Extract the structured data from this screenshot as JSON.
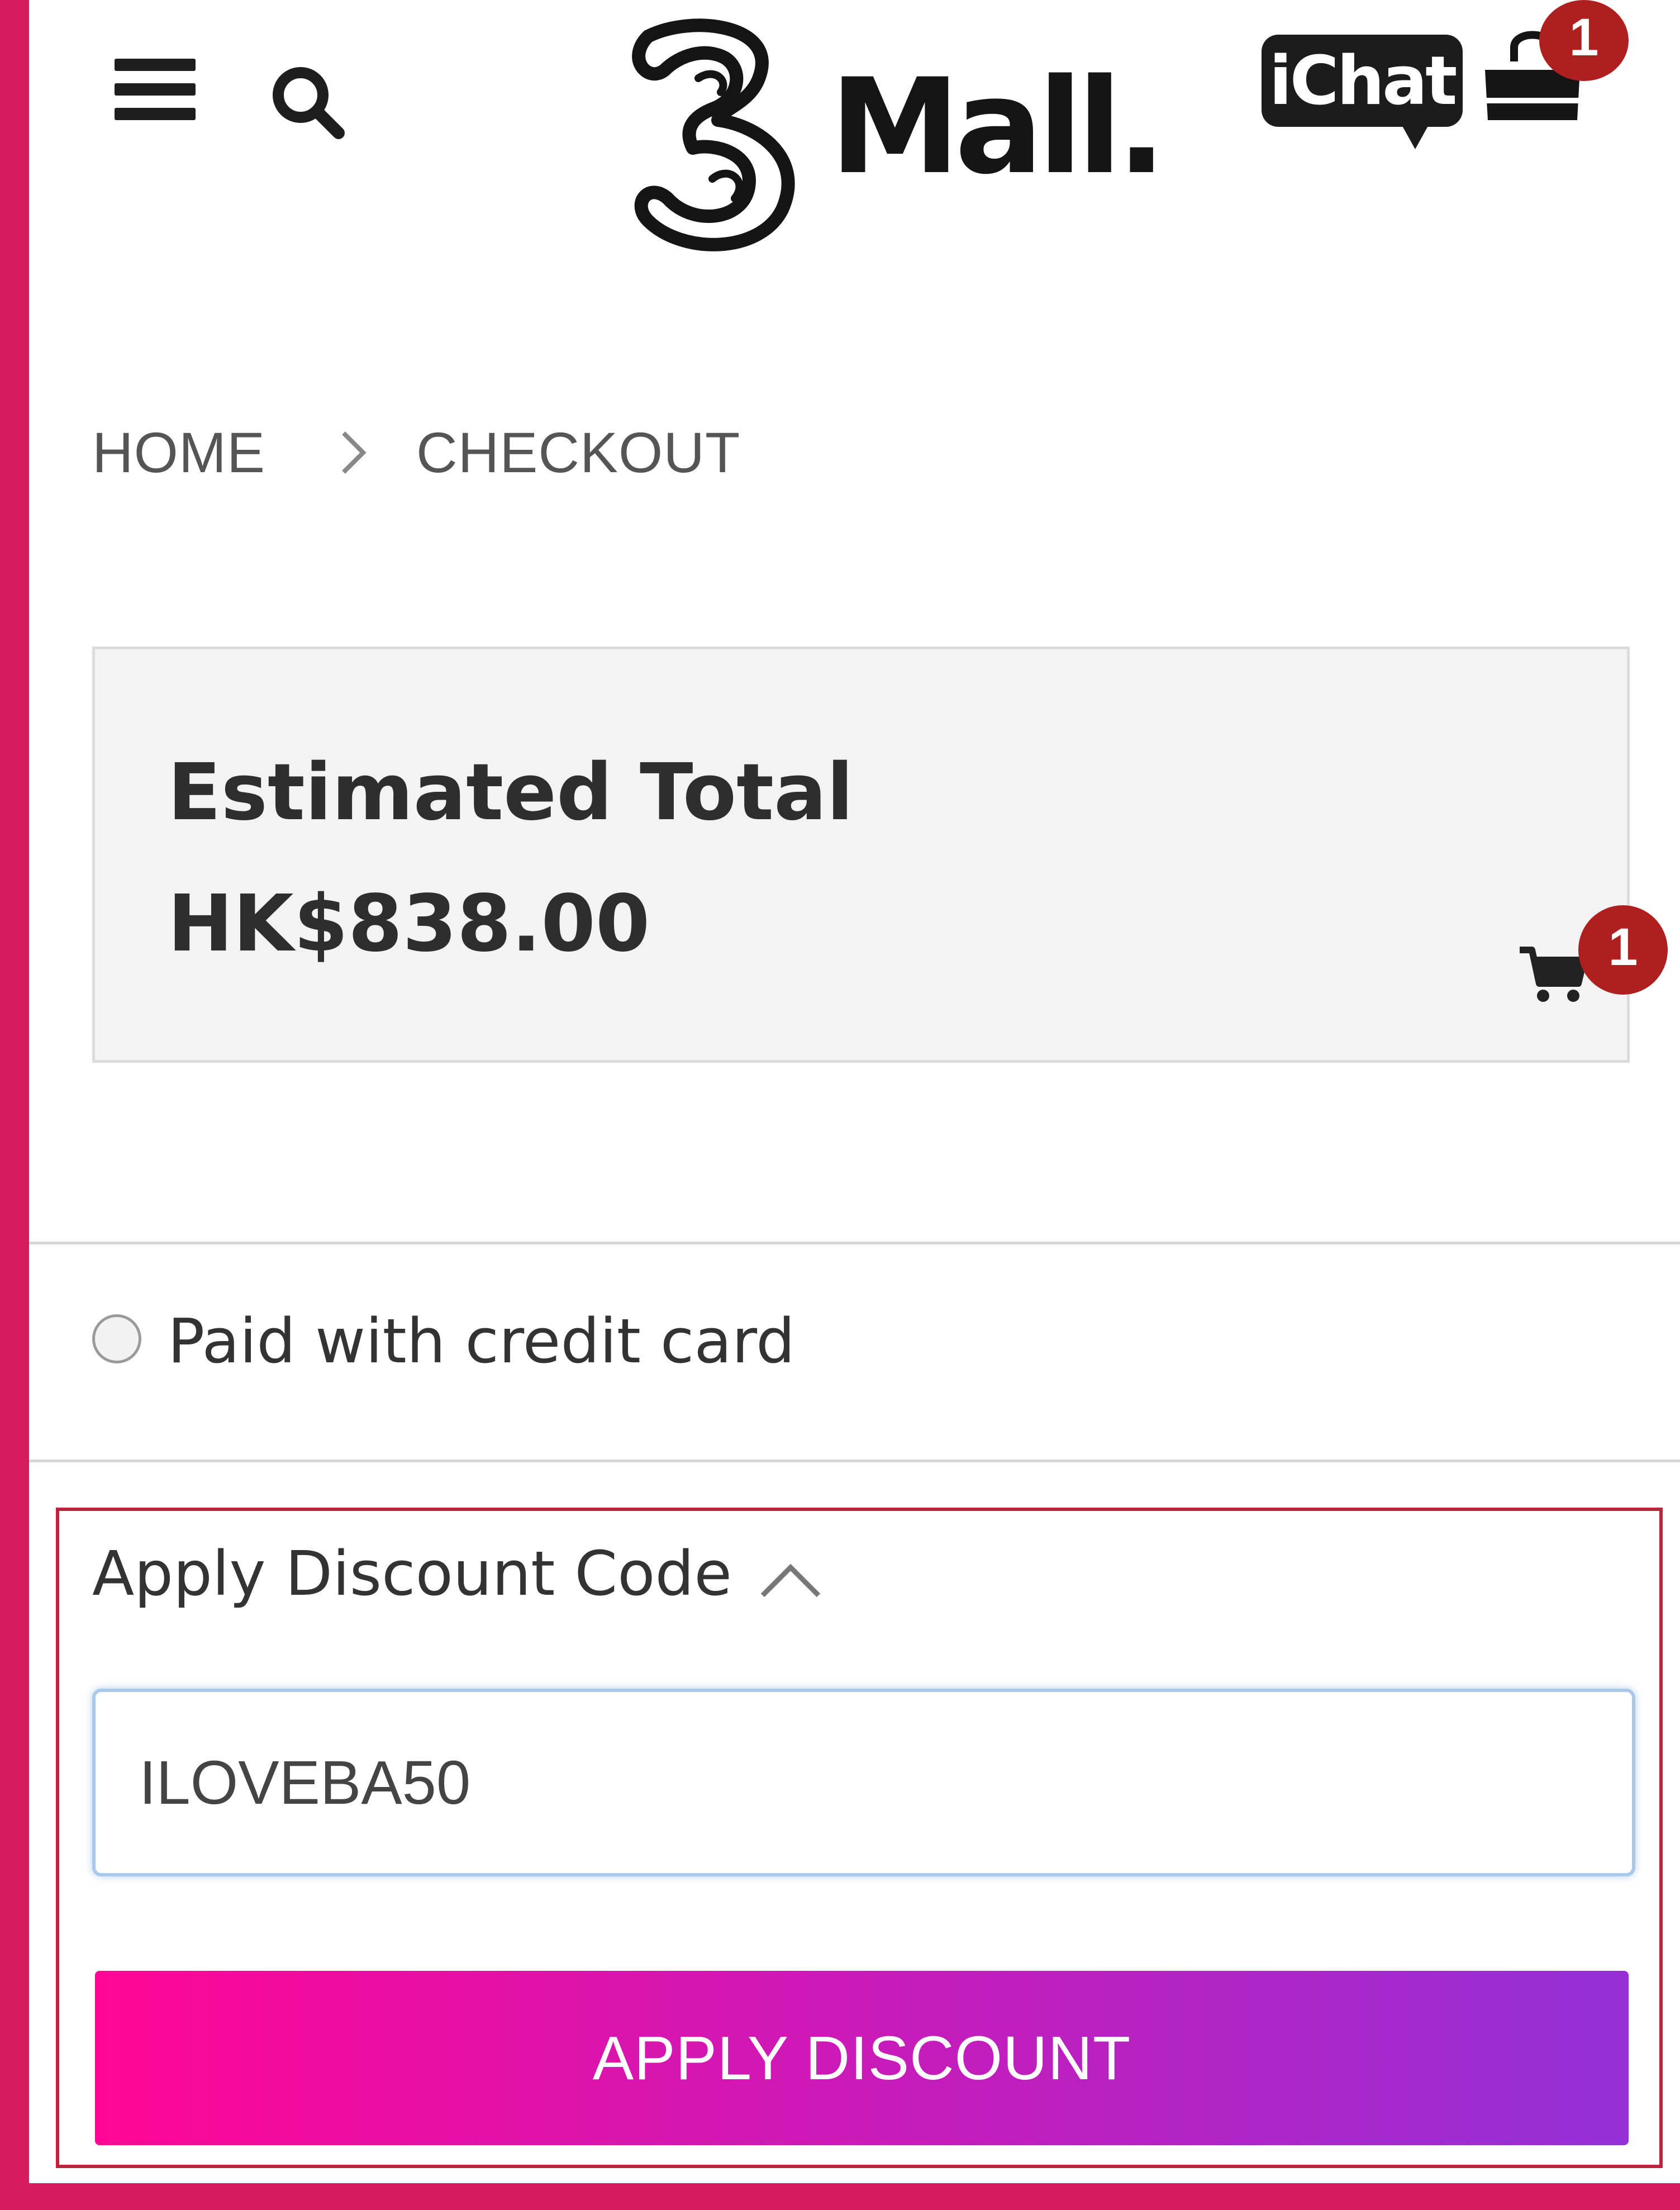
{
  "header": {
    "logo_text": "Mall.",
    "chat_label": "iChat",
    "bag_badge_count": "1",
    "icons": [
      "menu-icon",
      "search-icon",
      "logo-three-icon",
      "ichat-icon",
      "shopping-bag-icon"
    ]
  },
  "breadcrumb": {
    "home": "HOME",
    "current": "CHECKOUT",
    "separator_icon": "chevron-right-icon"
  },
  "summary": {
    "label": "Estimated Total",
    "value": "HK$838.00",
    "cart_badge_count": "1",
    "cart_icon": "cart-icon"
  },
  "payment": {
    "option_label": "Paid with credit card",
    "selected": false
  },
  "discount": {
    "title": "Apply Discount Code",
    "toggle_icon": "chevron-up-icon",
    "input_value": "ILOVEBA50",
    "button_label": "APPLY DISCOUNT"
  },
  "colors": {
    "frame": "#d81b5c",
    "badge": "#b01f1f",
    "button_gradient_start": "#ff0795",
    "button_gradient_end": "#9430d6",
    "highlight_border": "#c0213b"
  }
}
